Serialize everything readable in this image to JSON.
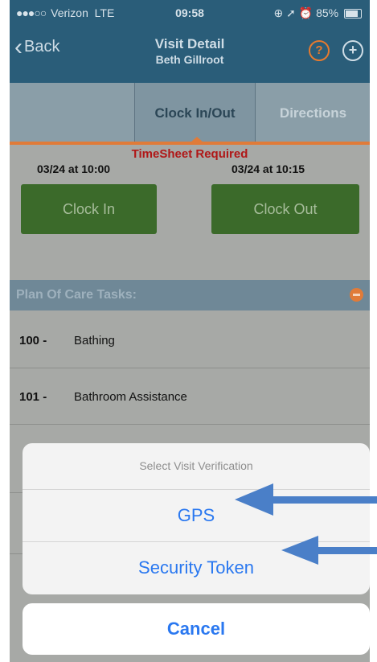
{
  "status_bar": {
    "carrier": "Verizon",
    "network": "LTE",
    "time": "09:58",
    "battery": "85%"
  },
  "nav": {
    "back_label": "Back",
    "title": "Visit Detail",
    "subtitle": "Beth Gillroot",
    "help_glyph": "?",
    "add_glyph": "+"
  },
  "tabs": [
    {
      "label": "Clock In/Out",
      "active": true
    },
    {
      "label": "Directions",
      "active": false
    }
  ],
  "clock": {
    "timesheet_notice": "TimeSheet Required",
    "clock_in_time": "03/24 at 10:00",
    "clock_out_time": "03/24 at 10:15",
    "clock_in_label": "Clock In",
    "clock_out_label": "Clock Out"
  },
  "plan_of_care": {
    "header": "Plan Of Care Tasks:",
    "tasks": [
      {
        "code": "100 -",
        "name": "Bathing"
      },
      {
        "code": "101 -",
        "name": "Bathroom Assistance"
      }
    ]
  },
  "action_sheet": {
    "title": "Select Visit Verification",
    "options": [
      "GPS",
      "Security Token"
    ],
    "cancel_label": "Cancel"
  },
  "colors": {
    "nav_bar": "#2a5d79",
    "accent_orange": "#e07b39",
    "clock_button_green": "#3b6a2a",
    "alert_red": "#b01717",
    "ios_blue": "#2a78f0",
    "arrow_blue": "#4a7fc8"
  },
  "icons": {
    "back": "chevron-left-icon",
    "help": "question-circle-icon",
    "add": "plus-circle-icon",
    "collapse": "minus-circle-icon",
    "annotation": "arrow-left-icon"
  }
}
